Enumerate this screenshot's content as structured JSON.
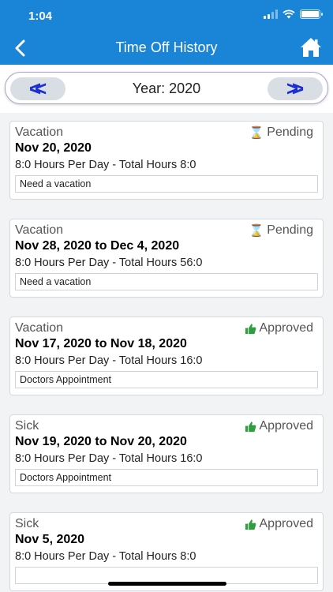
{
  "status_bar": {
    "time": "1:04"
  },
  "header": {
    "title": "Time Off History"
  },
  "year_nav": {
    "label": "Year: 2020",
    "prev_label": "<<",
    "next_label": ">>"
  },
  "colors": {
    "header": "#1a84d6",
    "pending": "#f0a500",
    "approved": "#2e9e3e",
    "nav_arrows": "#1c2fd6"
  },
  "requests": [
    {
      "type": "Vacation",
      "status": "Pending",
      "status_icon": "hourglass-icon",
      "dates": "Nov 20, 2020",
      "hours": "8:0 Hours Per Day - Total Hours 8:0",
      "note": "Need a vacation"
    },
    {
      "type": "Vacation",
      "status": "Pending",
      "status_icon": "hourglass-icon",
      "dates": "Nov 28, 2020 to Dec 4, 2020",
      "hours": "8:0 Hours Per Day - Total Hours 56:0",
      "note": "Need a vacation"
    },
    {
      "type": "Vacation",
      "status": "Approved",
      "status_icon": "thumbs-up-icon",
      "dates": "Nov 17, 2020 to Nov 18, 2020",
      "hours": "8:0 Hours Per Day - Total Hours 16:0",
      "note": "Doctors Appointment"
    },
    {
      "type": "Sick",
      "status": "Approved",
      "status_icon": "thumbs-up-icon",
      "dates": "Nov 19, 2020 to Nov 20, 2020",
      "hours": "8:0 Hours Per Day - Total Hours 16:0",
      "note": "Doctors Appointment"
    },
    {
      "type": "Sick",
      "status": "Approved",
      "status_icon": "thumbs-up-icon",
      "dates": "Nov 5, 2020",
      "hours": "8:0 Hours Per Day - Total Hours 8:0",
      "note": ""
    }
  ]
}
